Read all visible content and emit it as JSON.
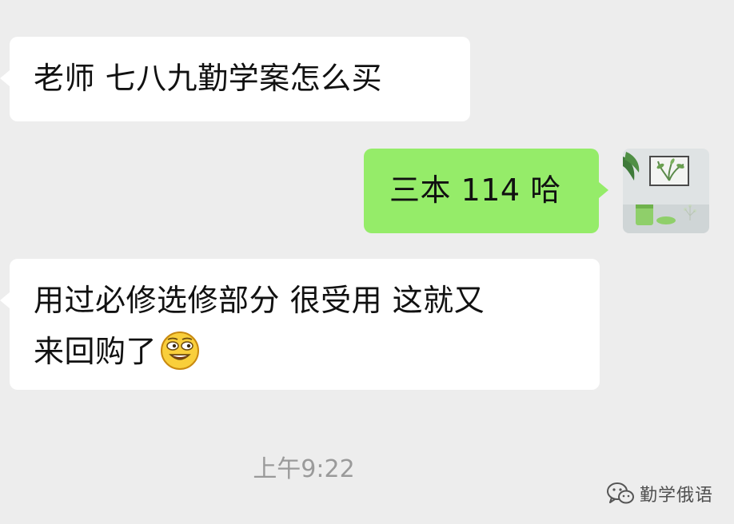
{
  "messages": [
    {
      "side": "incoming",
      "text": "老师 七八九勤学案怎么买"
    },
    {
      "side": "outgoing",
      "text": "三本 114 哈"
    },
    {
      "side": "incoming",
      "text_line1": "用过必修选修部分 很受用 这就又",
      "text_line2": "来回购了",
      "emoji": "grinning-squint-emoji"
    }
  ],
  "timestamp": "上午9:22",
  "watermark": {
    "icon": "wechat-icon",
    "text": "勤学俄语"
  },
  "colors": {
    "background": "#ededed",
    "incoming_bubble": "#ffffff",
    "outgoing_bubble": "#95ec69",
    "text": "#111111",
    "timestamp": "#9a9a9a"
  }
}
